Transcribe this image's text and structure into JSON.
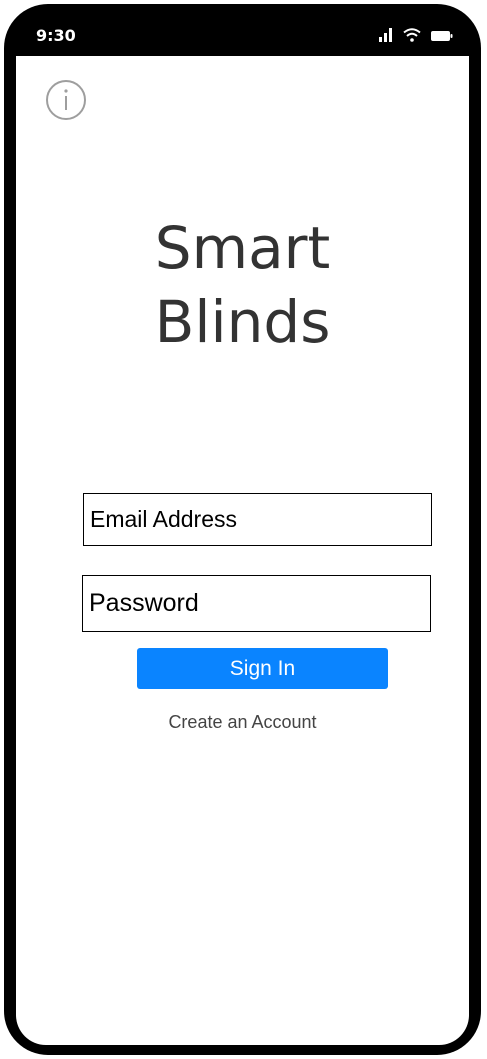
{
  "status_bar": {
    "time": "9:30",
    "icons": [
      "signal-icon",
      "wifi-icon",
      "battery-icon"
    ]
  },
  "header": {
    "info_icon": "info-icon"
  },
  "app": {
    "title_line1": "Smart",
    "title_line2": "Blinds"
  },
  "form": {
    "email_placeholder": "Email Address",
    "email_value": "",
    "password_placeholder": "Password",
    "password_value": "",
    "sign_in_label": "Sign In",
    "create_account_label": "Create an Account"
  },
  "colors": {
    "primary_button": "#0a84ff",
    "title_text": "#333333",
    "phone_frame": "#000000"
  }
}
